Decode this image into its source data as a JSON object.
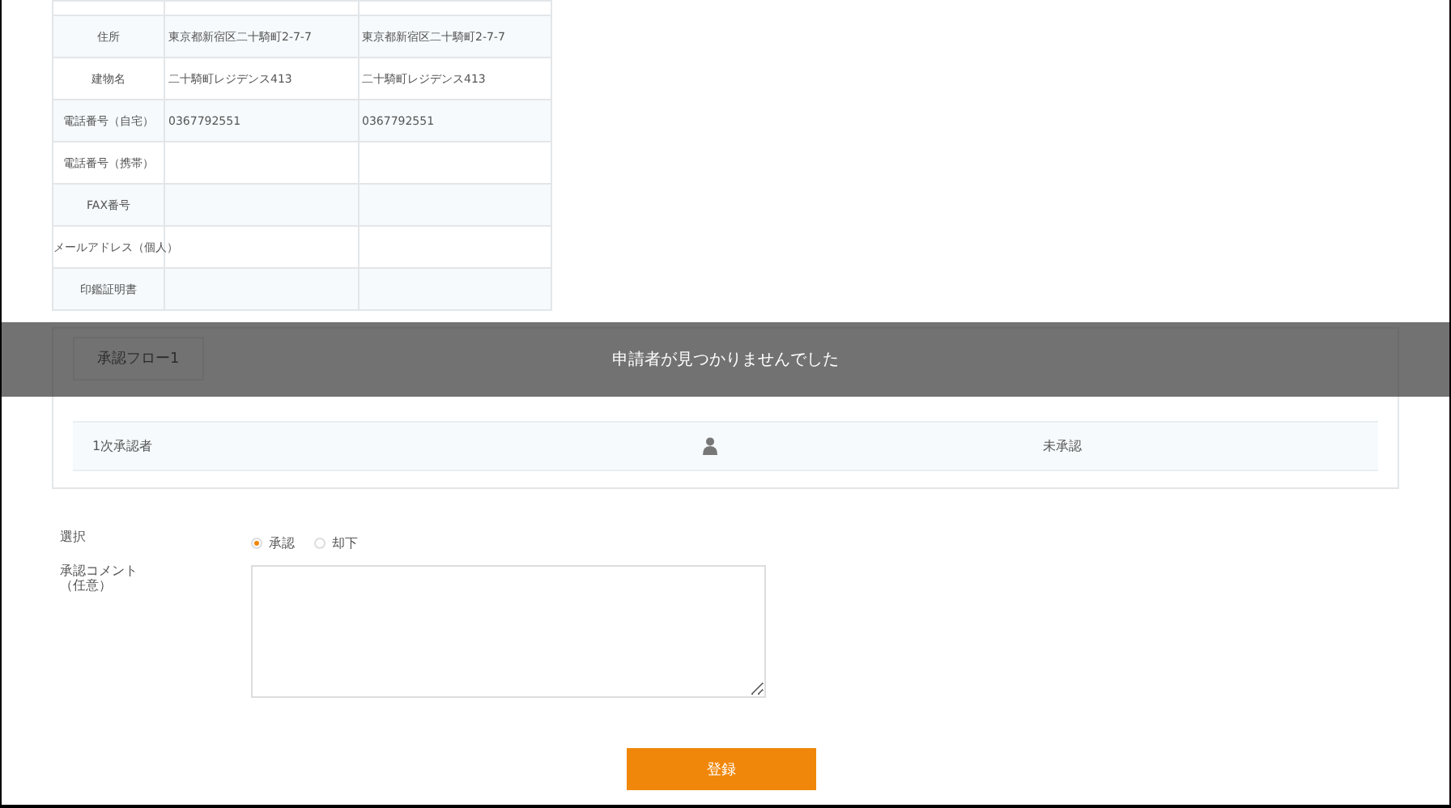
{
  "applicant_table": {
    "rows": [
      {
        "label": "住所",
        "value_1": "東京都新宿区二十騎町2-7-7",
        "value_2": "東京都新宿区二十騎町2-7-7"
      },
      {
        "label": "建物名",
        "value_1": "二十騎町レジデンス413",
        "value_2": "二十騎町レジデンス413"
      },
      {
        "label": "電話番号（自宅）",
        "value_1": "0367792551",
        "value_2": "0367792551"
      },
      {
        "label": "電話番号（携帯）"
      },
      {
        "label": "FAX番号"
      },
      {
        "label": "メールアドレス（個人）"
      },
      {
        "label": "印鑑証明書"
      }
    ]
  },
  "approval_flow": {
    "tab": "承認フロー1",
    "rows": [
      {
        "role": "1次承認者",
        "status": "未承認"
      }
    ]
  },
  "form": {
    "choice_label": "選択",
    "options": [
      {
        "label": "承認",
        "selected": true
      },
      {
        "label": "却下",
        "selected": false
      }
    ],
    "comment_label": [
      "承認コメント",
      "（任意）"
    ],
    "submit": "登録"
  },
  "toast": {
    "message": "申請者が見つかりませんでした"
  }
}
